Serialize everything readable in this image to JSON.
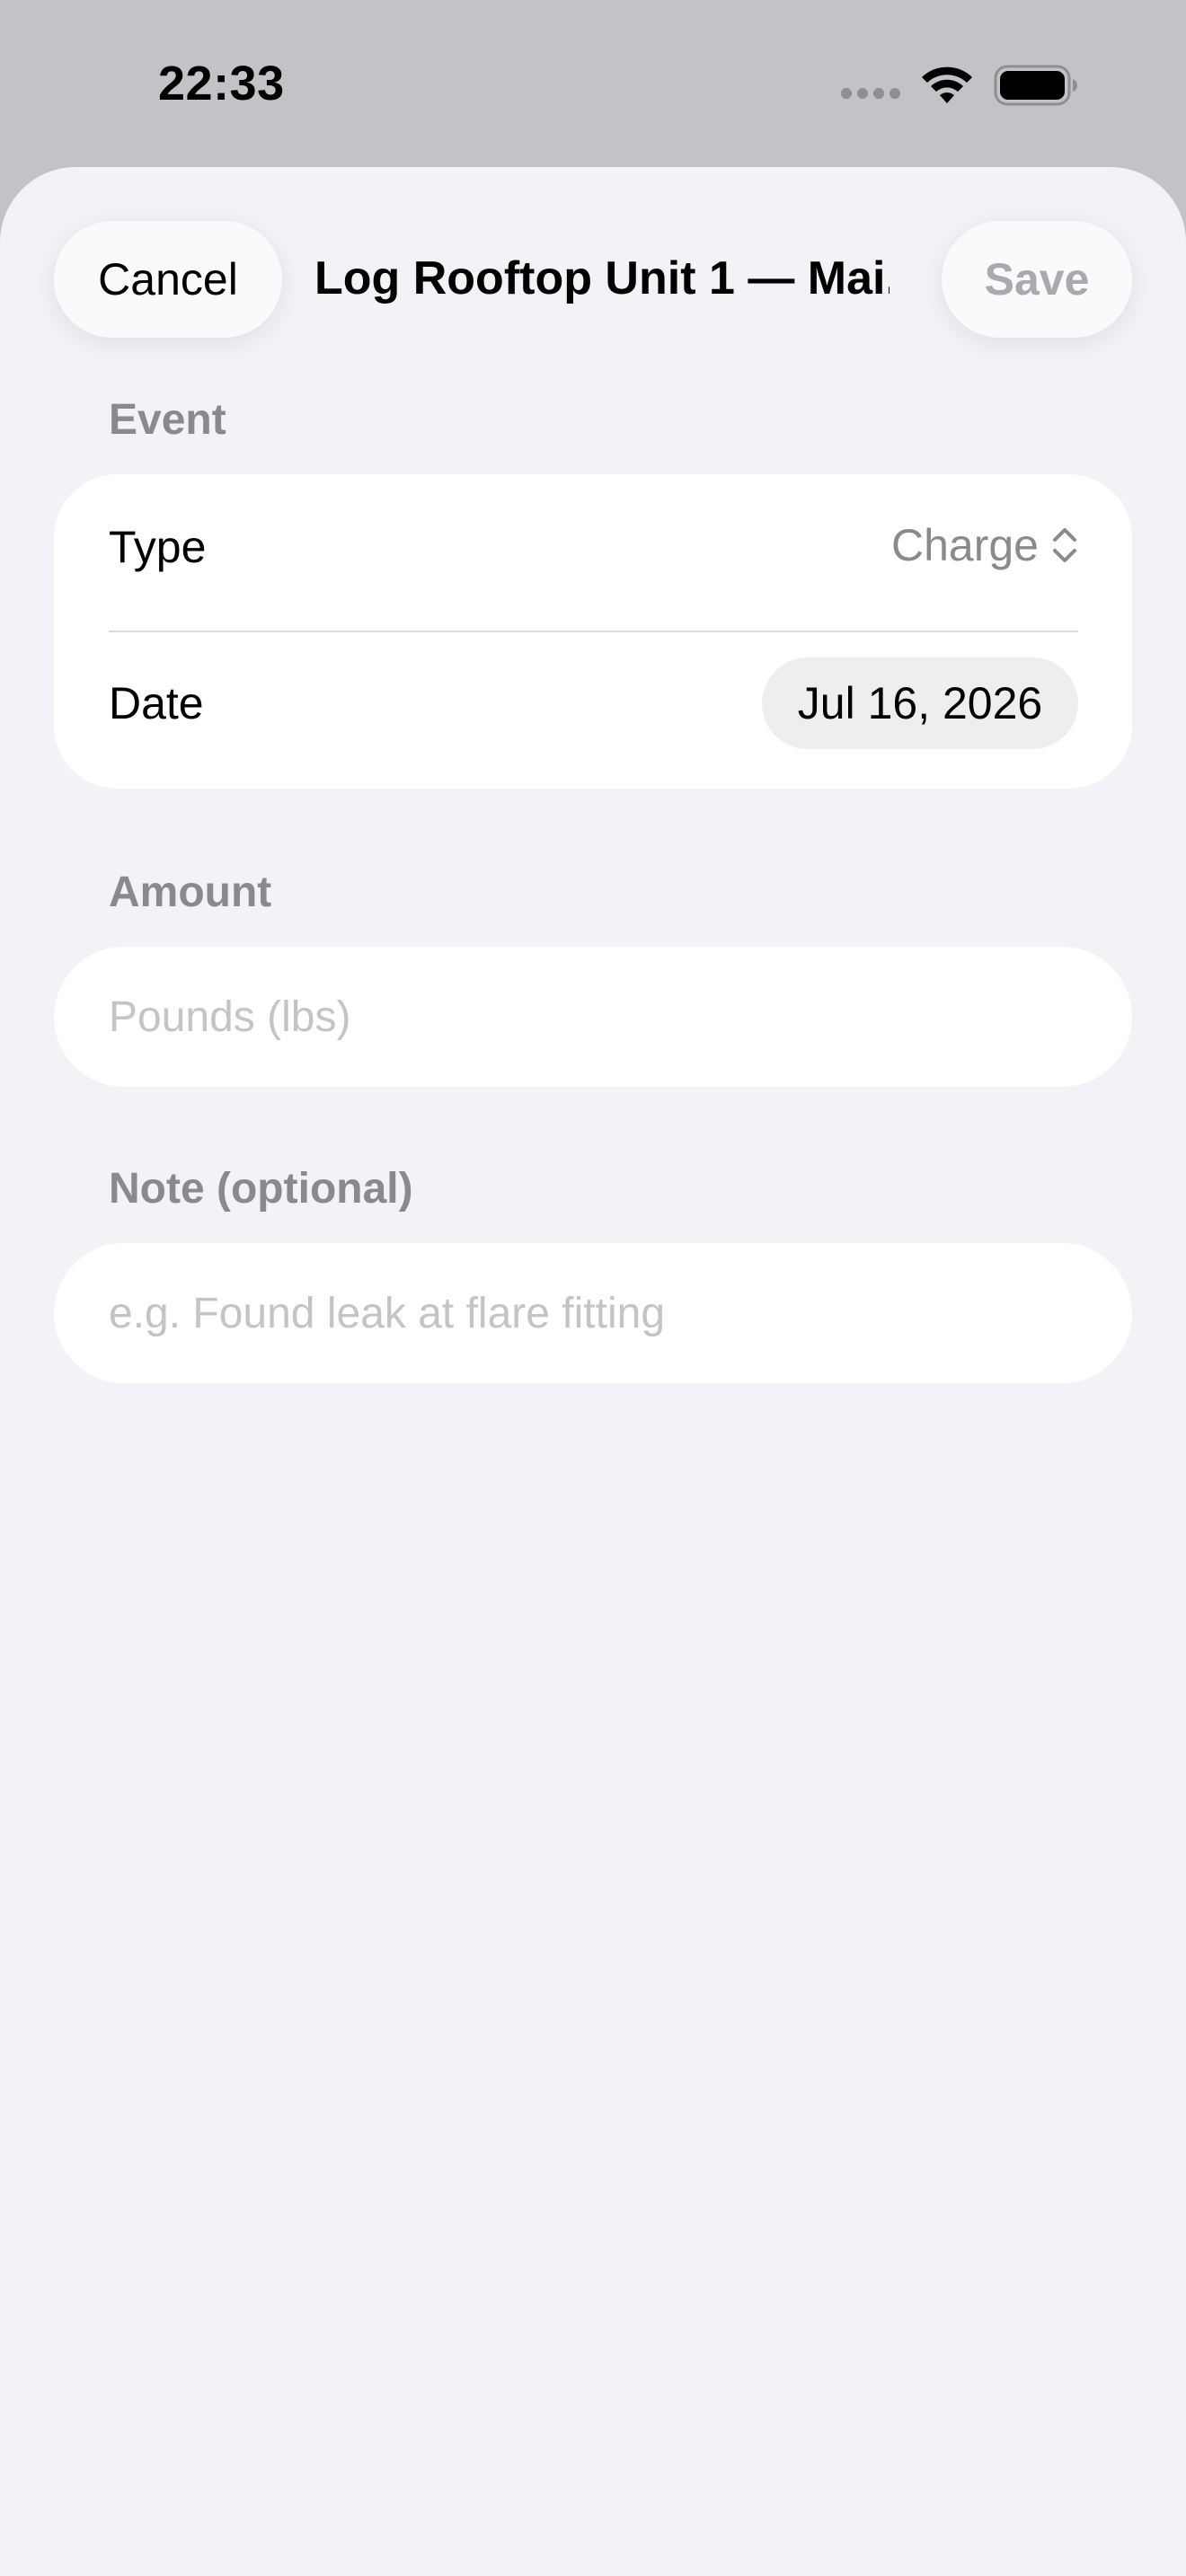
{
  "status_bar": {
    "time": "22:33",
    "icons": [
      "cellular-signal-icon",
      "wifi-icon",
      "battery-icon"
    ]
  },
  "nav": {
    "cancel_label": "Cancel",
    "title": "Log Rooftop Unit 1 — Mai...",
    "save_label": "Save"
  },
  "event_section": {
    "header": "Event",
    "type_label": "Type",
    "type_value": "Charge",
    "date_label": "Date",
    "date_value": "Jul 16, 2026"
  },
  "amount_section": {
    "header": "Amount",
    "placeholder": "Pounds (lbs)",
    "value": ""
  },
  "note_section": {
    "header": "Note (optional)",
    "placeholder": "e.g. Found leak at flare fitting",
    "value": ""
  },
  "colors": {
    "sheet_background": "#f2f2f7",
    "card_background": "#ffffff",
    "secondary_text": "#8a8a8e",
    "disabled_text": "#a9a9ae"
  }
}
